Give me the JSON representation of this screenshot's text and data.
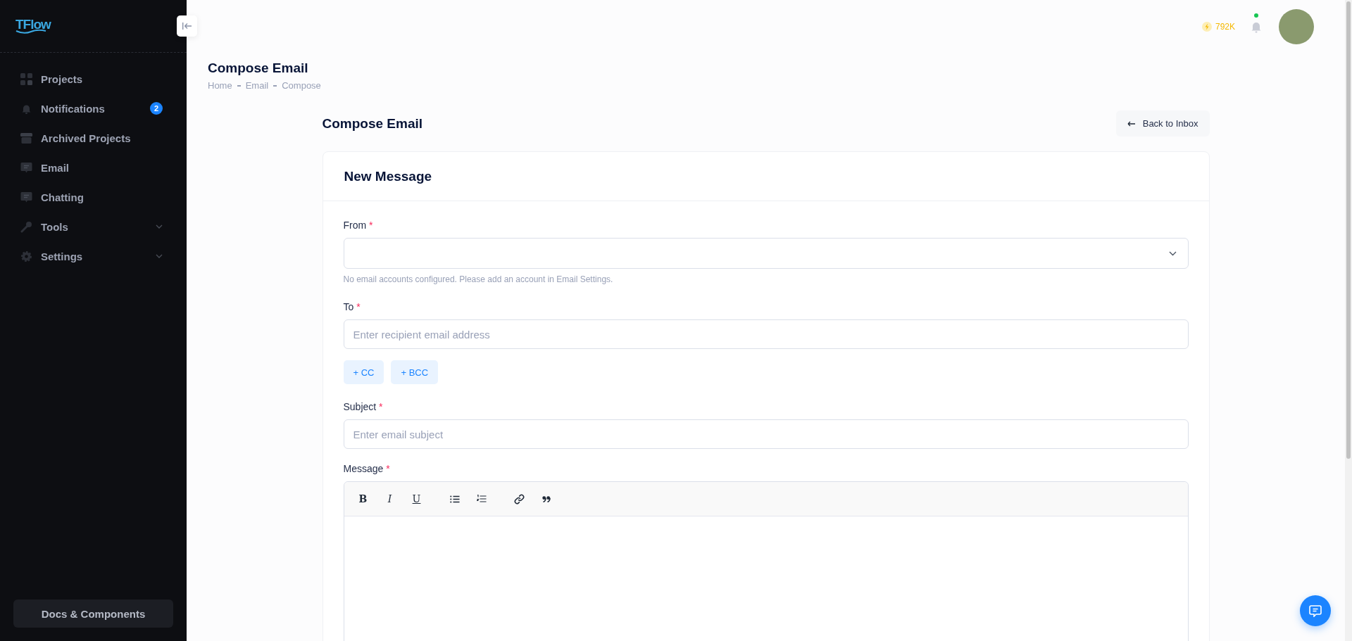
{
  "sidebar": {
    "logo": "TFlow",
    "items": [
      {
        "label": "Projects",
        "expandable": false
      },
      {
        "label": "Notifications",
        "expandable": false,
        "badge": "2"
      },
      {
        "label": "Archived Projects",
        "expandable": false
      },
      {
        "label": "Email",
        "expandable": false
      },
      {
        "label": "Chatting",
        "expandable": false
      },
      {
        "label": "Tools",
        "expandable": true
      },
      {
        "label": "Settings",
        "expandable": true
      }
    ],
    "footer_button": "Docs & Components"
  },
  "topbar": {
    "credits": "792K",
    "notification_dot": true
  },
  "page": {
    "title": "Compose Email",
    "breadcrumb": [
      "Home",
      "Email",
      "Compose"
    ]
  },
  "compose": {
    "title": "Compose Email",
    "back_button": "Back to Inbox",
    "card_title": "New Message",
    "from": {
      "label": "From",
      "required_mark": "*",
      "help": "No email accounts configured. Please add an account in Email Settings."
    },
    "to": {
      "label": "To",
      "required_mark": "*",
      "placeholder": "Enter recipient email address"
    },
    "copy_buttons": [
      "+ CC",
      "+ BCC"
    ],
    "subject": {
      "label": "Subject",
      "required_mark": "*",
      "placeholder": "Enter email subject"
    },
    "message": {
      "label": "Message",
      "required_mark": "*",
      "toolbar": [
        [
          {
            "kind": "bold",
            "glyph": "B"
          },
          {
            "kind": "italic",
            "glyph": "I"
          },
          {
            "kind": "underline",
            "glyph": "U"
          }
        ],
        [
          {
            "kind": "bullets"
          },
          {
            "kind": "numbers"
          }
        ],
        [
          {
            "kind": "link"
          },
          {
            "kind": "quote"
          }
        ]
      ]
    }
  }
}
